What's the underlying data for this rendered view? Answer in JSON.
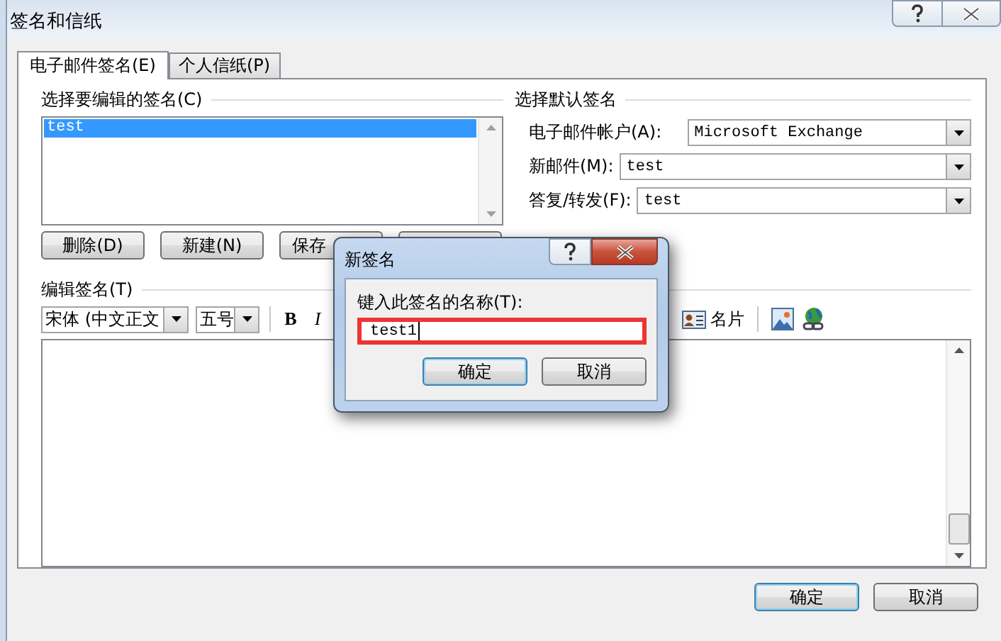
{
  "window": {
    "title": "签名和信纸"
  },
  "tabs": [
    {
      "label": "电子邮件签名(E)",
      "selected": true
    },
    {
      "label": "个人信纸(P)",
      "selected": false
    }
  ],
  "signature_list": {
    "heading": "选择要编辑的签名(C)",
    "items": [
      {
        "label": "test",
        "selected": true
      }
    ]
  },
  "list_buttons": [
    {
      "kind": "text",
      "label": "删除(D)"
    },
    {
      "kind": "text",
      "label": "新建(N)"
    },
    {
      "kind": "text",
      "label": "保存"
    },
    {
      "kind": "covered"
    }
  ],
  "default_signature": {
    "heading": "选择默认签名",
    "rows": [
      {
        "label": "电子邮件帐户(A):",
        "value": "Microsoft Exchange"
      },
      {
        "label": "新邮件(M):",
        "value": "test"
      },
      {
        "label": "答复/转发(F):",
        "value": "test"
      }
    ]
  },
  "editor": {
    "heading": "编辑签名(T)",
    "font": "宋体 (中文正文",
    "size": "五号",
    "bold": "B",
    "italic": "I",
    "business_card": "名片"
  },
  "footer_buttons": [
    {
      "label": "确定",
      "default": true
    },
    {
      "label": "取消",
      "default": false
    }
  ],
  "new_signature_dialog": {
    "title": "新签名",
    "prompt": "键入此签名的名称(T):",
    "value": "test1",
    "highlighted": true,
    "buttons": [
      {
        "label": "确定",
        "default": true
      },
      {
        "label": "取消",
        "default": false
      }
    ]
  }
}
